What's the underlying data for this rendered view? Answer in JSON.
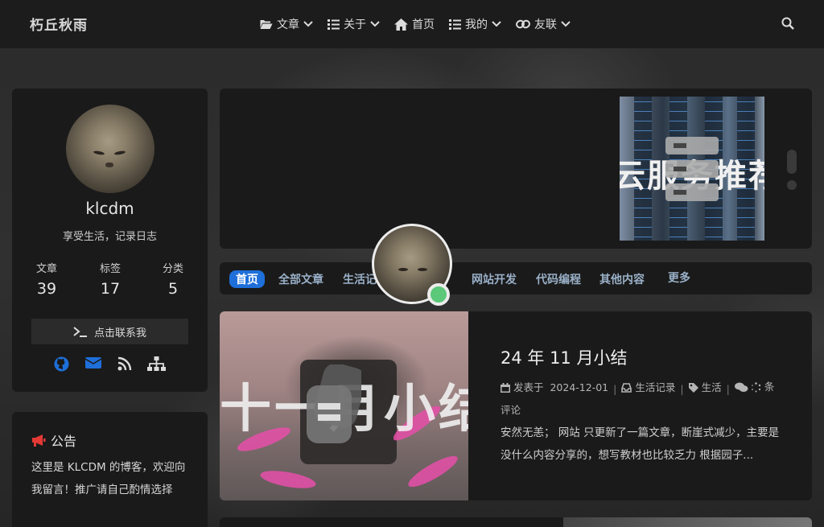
{
  "nav": {
    "brand": "朽丘秋雨",
    "items": [
      {
        "label": "文章",
        "icon": "folder-open-icon",
        "dropdown": true
      },
      {
        "label": "关于",
        "icon": "list-icon",
        "dropdown": true
      },
      {
        "label": "首页",
        "icon": "home-icon",
        "dropdown": false
      },
      {
        "label": "我的",
        "icon": "list-icon",
        "dropdown": true
      },
      {
        "label": "友联",
        "icon": "link-icon",
        "dropdown": true
      }
    ],
    "search_icon": "search-icon"
  },
  "profile": {
    "username": "klcdm",
    "motto": "享受生活，记录日志",
    "stats": [
      {
        "label": "文章",
        "value": "39"
      },
      {
        "label": "标签",
        "value": "17"
      },
      {
        "label": "分类",
        "value": "5"
      }
    ],
    "contact_label": "点击联系我",
    "social_icons": [
      "github-icon",
      "mail-icon",
      "rss-icon",
      "sitemap-icon"
    ]
  },
  "notice": {
    "title": "公告",
    "text": "这里是 KLCDM 的博客，欢迎向我留言！推广请自己酌情选择"
  },
  "banner": {
    "text": "云服务推荐"
  },
  "tabs": [
    {
      "label": "首页",
      "active": true
    },
    {
      "label": "全部文章",
      "active": false
    },
    {
      "label": "生活记",
      "active": false
    },
    {
      "label": "网站开发",
      "active": false
    },
    {
      "label": "代码编程",
      "active": false
    },
    {
      "label": "其他内容",
      "active": false
    },
    {
      "label": "更多",
      "active": false
    }
  ],
  "post": {
    "thumb_text": "十一月小结",
    "title": "24 年 11 月小结",
    "meta_published_label": "发表于",
    "meta_date": "2024-12-01",
    "meta_category": "生活记录",
    "meta_tag": "生活",
    "meta_comments_suffix": "条",
    "meta_comments_label": "评论",
    "excerpt": "安然无恙；  网站 只更新了一篇文章，断崖式减少，主要是没什么内容分享的，想写教材也比较乏力 根据园子..."
  },
  "colors": {
    "accent": "#1e6fd9",
    "online": "#5cc879",
    "notice_icon": "#e53935",
    "social": "#1e6fd9"
  }
}
